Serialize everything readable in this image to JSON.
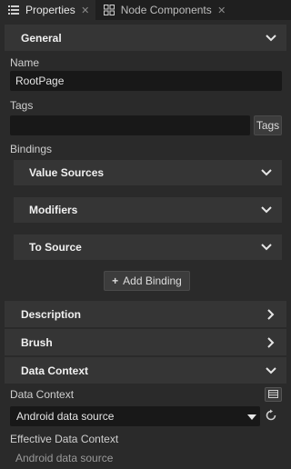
{
  "tabs": [
    {
      "label": "Properties",
      "active": true,
      "icon": "list-icon"
    },
    {
      "label": "Node Components",
      "active": false,
      "icon": "components-icon"
    }
  ],
  "general": {
    "header": "General",
    "name_label": "Name",
    "name_value": "RootPage",
    "tags_label": "Tags",
    "tags_value": "",
    "tags_button": "Tags",
    "bindings_label": "Bindings",
    "value_sources": "Value Sources",
    "modifiers": "Modifiers",
    "to_source": "To Source",
    "add_binding": "Add Binding"
  },
  "description": {
    "header": "Description"
  },
  "brush": {
    "header": "Brush"
  },
  "data_context": {
    "header": "Data Context",
    "label": "Data Context",
    "selected": "Android data source",
    "effective_label": "Effective Data Context",
    "effective_value": "Android data source"
  },
  "colors": {
    "background": "#2a2a2a",
    "tabbar": "#1f1f1f",
    "section": "#353535",
    "field": "#181818"
  }
}
